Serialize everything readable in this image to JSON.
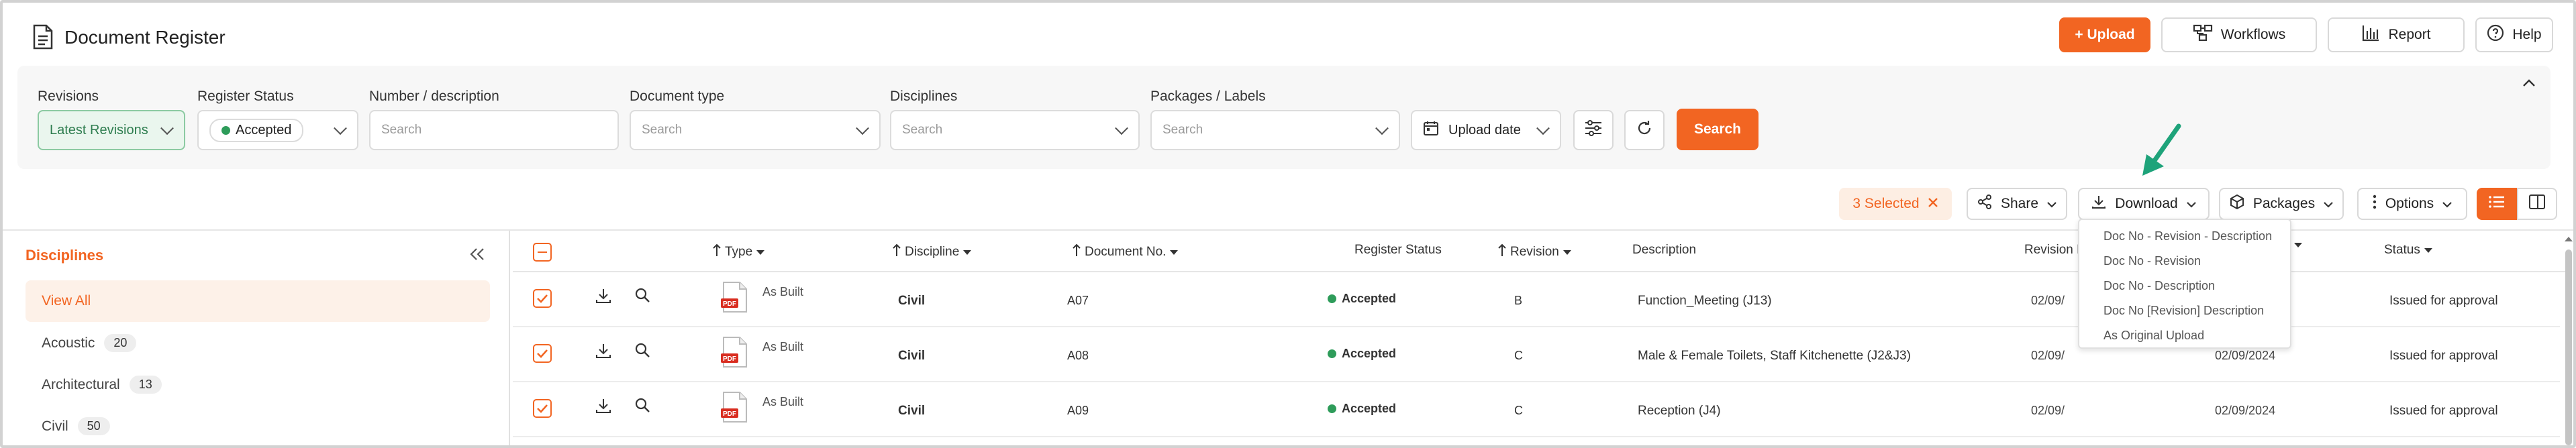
{
  "header": {
    "title": "Document Register",
    "upload_label": "+ Upload",
    "workflows_label": "Workflows",
    "report_label": "Report",
    "help_label": "Help"
  },
  "filters": {
    "revisions": {
      "label": "Revisions",
      "value": "Latest Revisions"
    },
    "register_status": {
      "label": "Register Status",
      "value": "Accepted"
    },
    "number_desc": {
      "label": "Number / description",
      "placeholder": "Search"
    },
    "doc_type": {
      "label": "Document type",
      "placeholder": "Search"
    },
    "disciplines": {
      "label": "Disciplines",
      "placeholder": "Search"
    },
    "packages": {
      "label": "Packages / Labels",
      "placeholder": "Search"
    },
    "upload_date_label": "Upload date",
    "search_label": "Search"
  },
  "toolbar": {
    "selected_label": "3 Selected",
    "share_label": "Share",
    "download_label": "Download",
    "packages_label": "Packages",
    "options_label": "Options"
  },
  "download_menu": [
    "Doc No - Revision - Description",
    "Doc No - Revision",
    "Doc No - Description",
    "Doc No [Revision] Description",
    "As Original Upload"
  ],
  "sidebar": {
    "title": "Disciplines",
    "items": [
      {
        "label": "View All",
        "count": ""
      },
      {
        "label": "Acoustic",
        "count": "20"
      },
      {
        "label": "Architectural",
        "count": "13"
      },
      {
        "label": "Civil",
        "count": "50"
      }
    ]
  },
  "table": {
    "headers": {
      "type": "Type",
      "discipline": "Discipline",
      "doc_no": "Document No.",
      "register_status": "Register Status",
      "revision": "Revision",
      "description": "Description",
      "revision_date": "Revision D",
      "status": "Status"
    },
    "rows": [
      {
        "type": "As Built",
        "discipline": "Civil",
        "doc_no": "A07",
        "register_status": "Accepted",
        "revision": "B",
        "description": "Function_Meeting (J13)",
        "revision_date": "02/09/",
        "upload_date": "",
        "status": "Issued for approval"
      },
      {
        "type": "As Built",
        "discipline": "Civil",
        "doc_no": "A08",
        "register_status": "Accepted",
        "revision": "C",
        "description": "Male & Female Toilets, Staff Kitchenette (J2&J3)",
        "revision_date": "02/09/",
        "upload_date": "02/09/2024",
        "status": "Issued for approval"
      },
      {
        "type": "As Built",
        "discipline": "Civil",
        "doc_no": "A09",
        "register_status": "Accepted",
        "revision": "C",
        "description": "Reception (J4)",
        "revision_date": "02/09/",
        "upload_date": "02/09/2024",
        "status": "Issued for approval"
      }
    ]
  },
  "colors": {
    "accent": "#f26522",
    "accepted": "#2e9c5a",
    "arrow": "#1ea37a"
  }
}
